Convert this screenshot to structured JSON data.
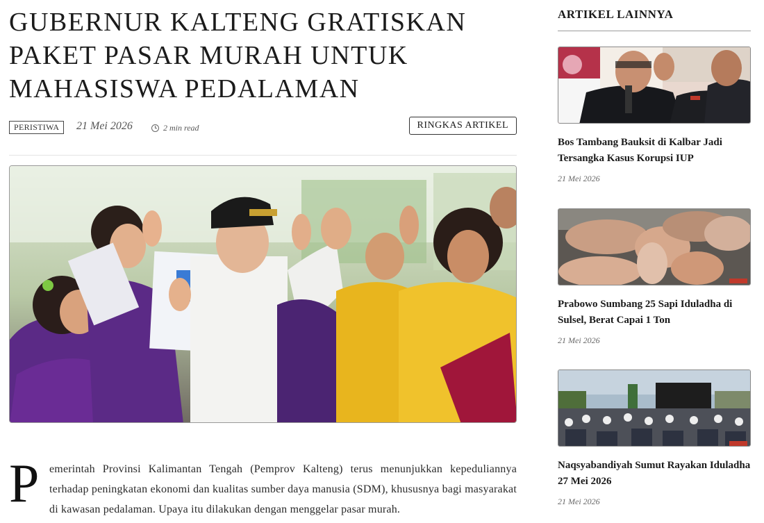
{
  "article": {
    "title_lines": [
      "GUBERNUR KALTENG GRATISKAN",
      "PAKET PASAR MURAH UNTUK",
      "MAHASISWA PEDALAMAN"
    ],
    "category": "PERISTIWA",
    "date": "21 Mei 2026",
    "read_time": "2 min read",
    "summary_button": "RINGKAS ARTIKEL",
    "dropcap": "P",
    "lead_paragraph": "emerintah Provinsi Kalimantan Tengah (Pemprov Kalteng) terus menunjukkan kepeduliannya terhadap peningkatan ekonomi dan kualitas sumber daya manusia (SDM), khususnya bagi masyarakat di kawasan pedalaman. Upaya itu dilakukan dengan menggelar pasar murah."
  },
  "sidebar": {
    "heading": "ARTIKEL LAINNYA",
    "items": [
      {
        "title": "Bos Tambang Bauksit di Kalbar Jadi Tersangka Kasus Korupsi IUP",
        "date": "21 Mei 2026"
      },
      {
        "title": "Prabowo Sumbang 25 Sapi Iduladha di Sulsel, Berat Capai 1 Ton",
        "date": "21 Mei 2026"
      },
      {
        "title": "Naqsyabandiyah Sumut Rayakan Iduladha 27 Mei 2026",
        "date": "21 Mei 2026"
      }
    ]
  },
  "colors": {
    "purple_jacket": "#5b2a86",
    "yellow_jacket": "#e8b51e",
    "accent_red": "#c0392b"
  }
}
